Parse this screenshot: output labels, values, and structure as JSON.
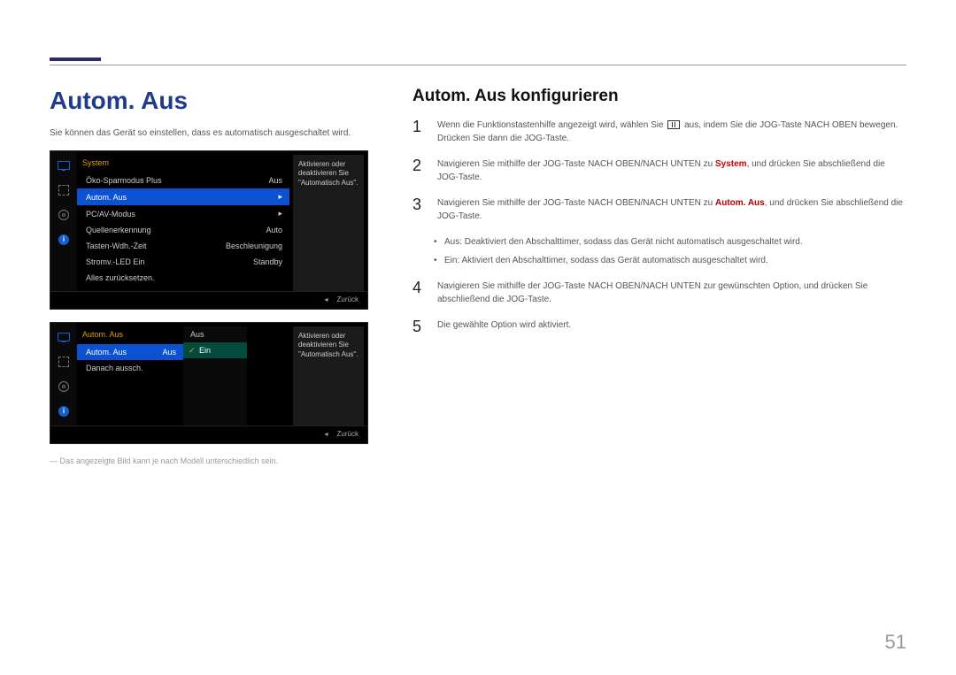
{
  "page_number": "51",
  "header": {
    "title": "Autom. Aus",
    "intro": "Sie können das Gerät so einstellen, dass es automatisch ausgeschaltet wird.",
    "footnote": "Das angezeigte Bild kann je nach Modell unterschiedlich sein."
  },
  "right": {
    "subtitle": "Autom. Aus konfigurieren",
    "steps": [
      {
        "num": "1",
        "pre": "Wenn die Funktionstastenhilfe angezeigt wird, wählen Sie ",
        "post": " aus, indem Sie die JOG-Taste NACH OBEN bewegen. Drücken Sie dann die JOG-Taste."
      },
      {
        "num": "2",
        "pre": "Navigieren Sie mithilfe der JOG-Taste NACH OBEN/NACH UNTEN zu ",
        "hl": "System",
        "post": ", und drücken Sie abschließend die JOG-Taste."
      },
      {
        "num": "3",
        "pre": "Navigieren Sie mithilfe der JOG-Taste NACH OBEN/NACH UNTEN zu ",
        "hl": "Autom. Aus",
        "post": ", und drücken Sie abschließend die JOG-Taste."
      },
      {
        "num": "4",
        "text": "Navigieren Sie mithilfe der JOG-Taste NACH OBEN/NACH UNTEN zur gewünschten Option, und drücken Sie abschließend die JOG-Taste."
      },
      {
        "num": "5",
        "text": "Die gewählte Option wird aktiviert."
      }
    ],
    "sublist": [
      {
        "bold": "Aus",
        "text": ": Deaktiviert den Abschalttimer, sodass das Gerät nicht automatisch ausgeschaltet wird."
      },
      {
        "bold": "Ein",
        "text": ": Aktiviert den Abschalttimer, sodass das Gerät automatisch ausgeschaltet wird."
      }
    ]
  },
  "osd1": {
    "title": "System",
    "rows": [
      {
        "label": "Öko-Sparmodus Plus",
        "value": "Aus"
      },
      {
        "label": "Autom. Aus",
        "value": "",
        "arrow": true,
        "selected": true
      },
      {
        "label": "PC/AV-Modus",
        "value": "",
        "arrow": true
      },
      {
        "label": "Quellenerkennung",
        "value": "Auto"
      },
      {
        "label": "Tasten-Wdh.-Zeit",
        "value": "Beschleunigung"
      },
      {
        "label": "Stromv.-LED Ein",
        "value": "Standby"
      },
      {
        "label": "Alles zurücksetzen.",
        "value": ""
      }
    ],
    "tooltip": "Aktivieren oder deaktivieren Sie \"Automatisch Aus\".",
    "back": "Zurück"
  },
  "osd2": {
    "title": "Autom. Aus",
    "rows": [
      {
        "label": "Autom. Aus",
        "value": "Aus",
        "selected": true
      },
      {
        "label": "Danach aussch.",
        "value": ""
      }
    ],
    "dropdown": [
      {
        "label": "Aus"
      },
      {
        "label": "Ein",
        "active": true
      }
    ],
    "tooltip": "Aktivieren oder deaktivieren Sie \"Automatisch Aus\".",
    "back": "Zurück"
  }
}
